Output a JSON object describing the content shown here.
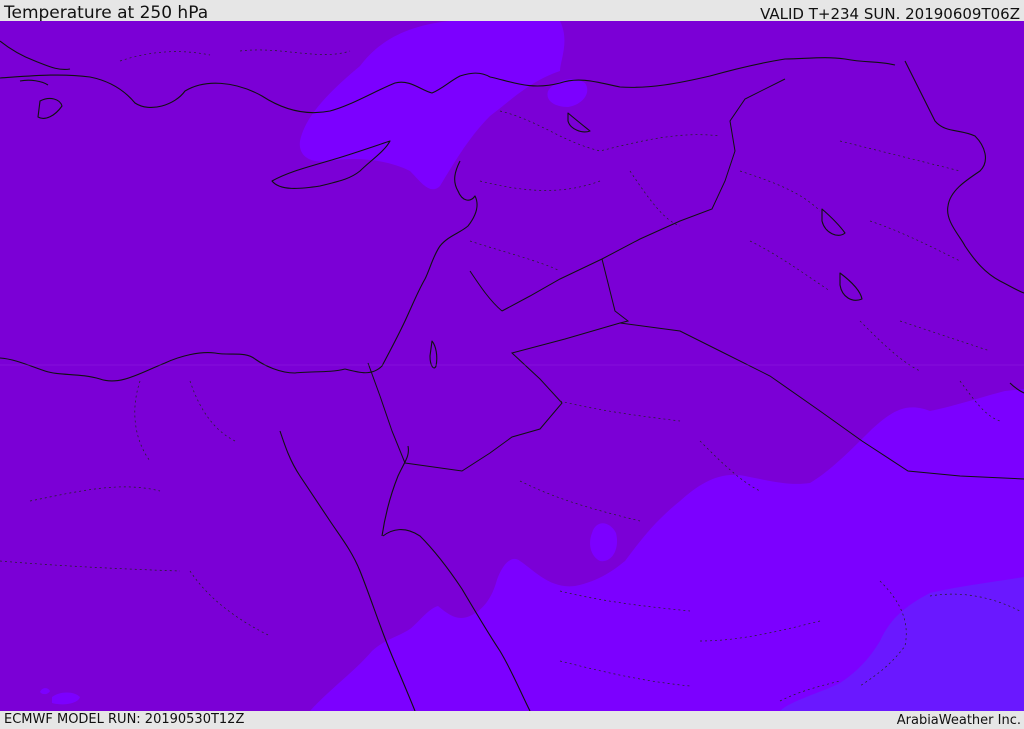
{
  "header": {
    "title": "Temperature at 250 hPa",
    "valid": "VALID T+234 SUN. 20190609T06Z"
  },
  "footer": {
    "model_run": "ECMWF MODEL RUN: 20190530T12Z",
    "brand": "ArabiaWeather Inc."
  },
  "map": {
    "field": "temperature",
    "level": "250 hPa",
    "colors": {
      "base": "#7b00d6",
      "warmer": "#7c00ff",
      "warmest": "#6a18ff",
      "coast": "#111111"
    }
  }
}
